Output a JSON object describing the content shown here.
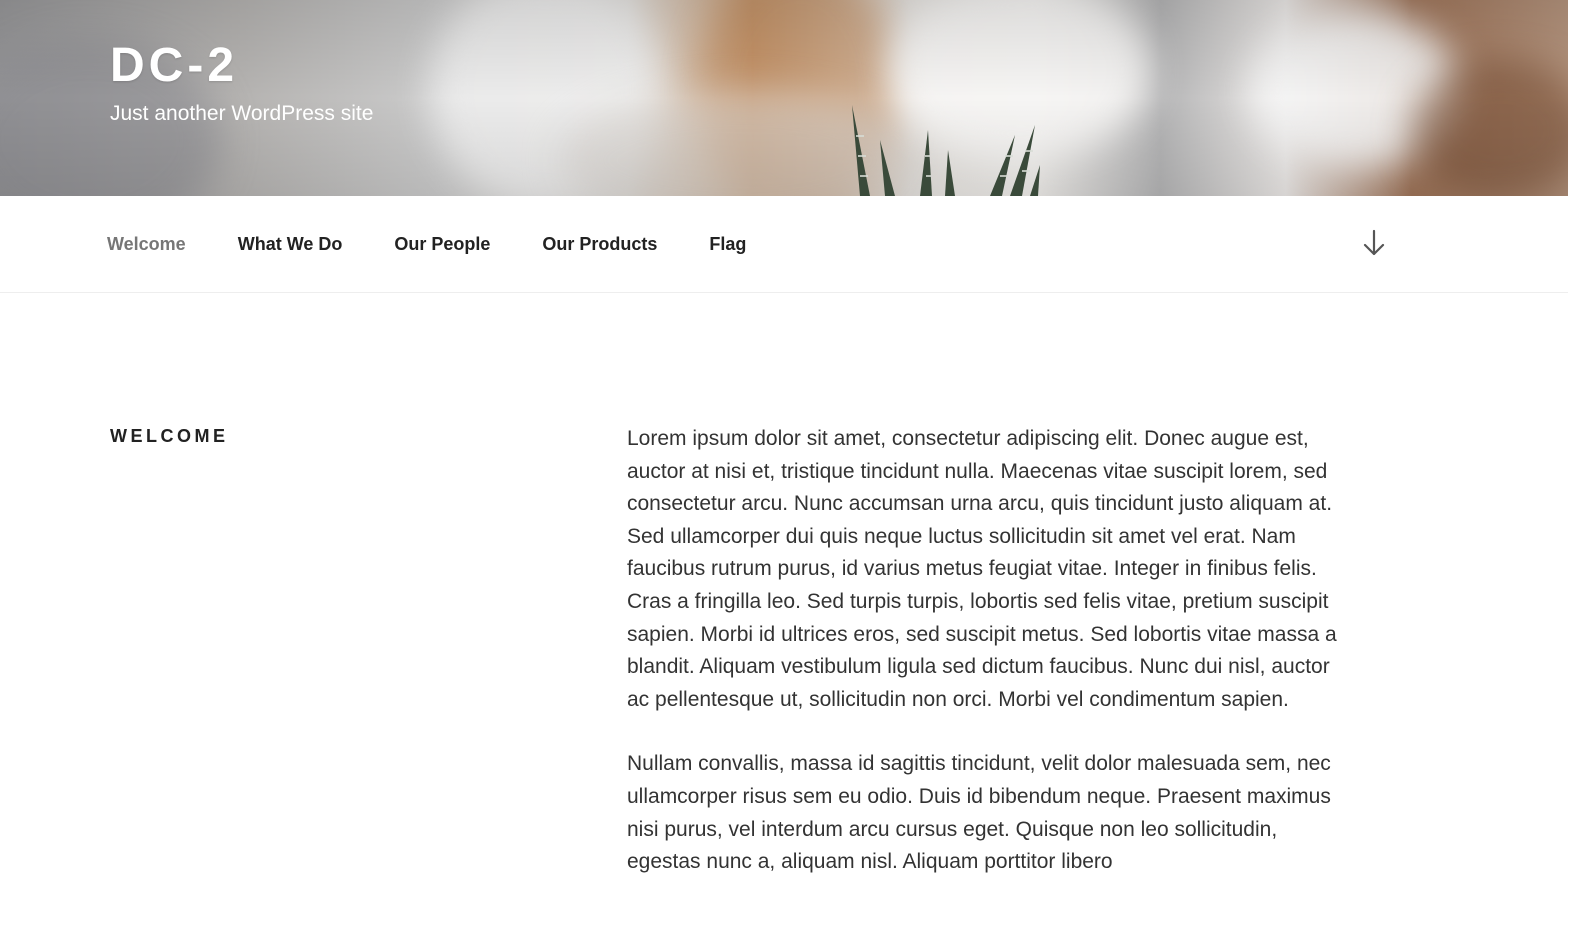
{
  "site": {
    "title": "DC-2",
    "description": "Just another WordPress site"
  },
  "nav": {
    "items": [
      {
        "label": "Welcome",
        "current": true
      },
      {
        "label": "What We Do",
        "current": false
      },
      {
        "label": "Our People",
        "current": false
      },
      {
        "label": "Our Products",
        "current": false
      },
      {
        "label": "Flag",
        "current": false
      }
    ],
    "scroll_icon": "arrow-down-icon"
  },
  "page": {
    "title": "WELCOME",
    "paragraphs": [
      "Lorem ipsum dolor sit amet, consectetur adipiscing elit. Donec augue est, auctor at nisi et, tristique tincidunt nulla. Maecenas vitae suscipit lorem, sed consectetur arcu. Nunc accumsan urna arcu, quis tincidunt justo aliquam at. Sed ullamcorper dui quis neque luctus sollicitudin sit amet vel erat. Nam faucibus rutrum purus, id varius metus feugiat vitae. Integer in finibus felis. Cras a fringilla leo. Sed turpis turpis, lobortis sed felis vitae, pretium suscipit sapien. Morbi id ultrices eros, sed suscipit metus. Sed lobortis vitae massa a blandit. Aliquam vestibulum ligula sed dictum faucibus. Nunc dui nisl, auctor ac pellentesque ut, sollicitudin non orci. Morbi vel condimentum sapien.",
      "Nullam convallis, massa id sagittis tincidunt, velit dolor malesuada sem, nec ullamcorper risus sem eu odio. Duis id bibendum neque. Praesent maximus nisi purus, vel interdum arcu cursus eget. Quisque non leo sollicitudin, egestas nunc a, aliquam nisl. Aliquam porttitor libero"
    ]
  },
  "colors": {
    "nav_text": "#222222",
    "nav_current": "#767676",
    "body_text": "#333333"
  }
}
